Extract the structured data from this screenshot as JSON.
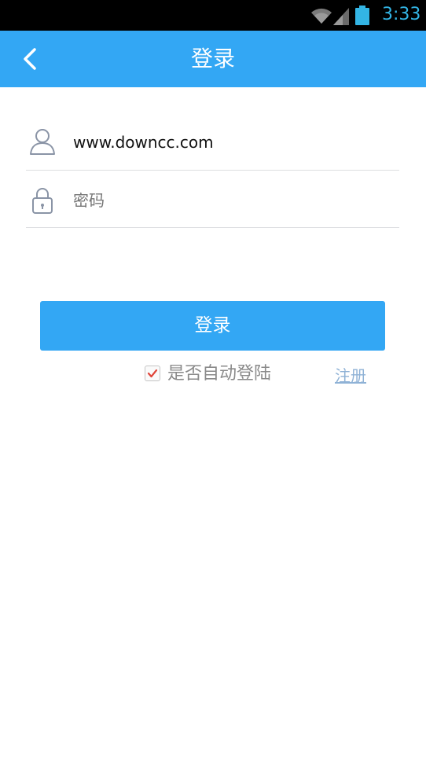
{
  "status_bar": {
    "time": "3:33",
    "icons": [
      "wifi-icon",
      "signal-icon",
      "battery-icon"
    ]
  },
  "header": {
    "title": "登录",
    "back_icon": "chevron-left-icon"
  },
  "form": {
    "username": {
      "icon": "user-icon",
      "value": "www.downcc.com"
    },
    "password": {
      "icon": "lock-icon",
      "placeholder": "密码"
    },
    "login_button": "登录",
    "auto_login": {
      "label": "是否自动登陆",
      "checked": true
    },
    "register_link": "注册"
  },
  "colors": {
    "accent": "#33a7f4",
    "status_text": "#33b5e5",
    "link": "#8fb2d6",
    "check": "#e0453a"
  }
}
